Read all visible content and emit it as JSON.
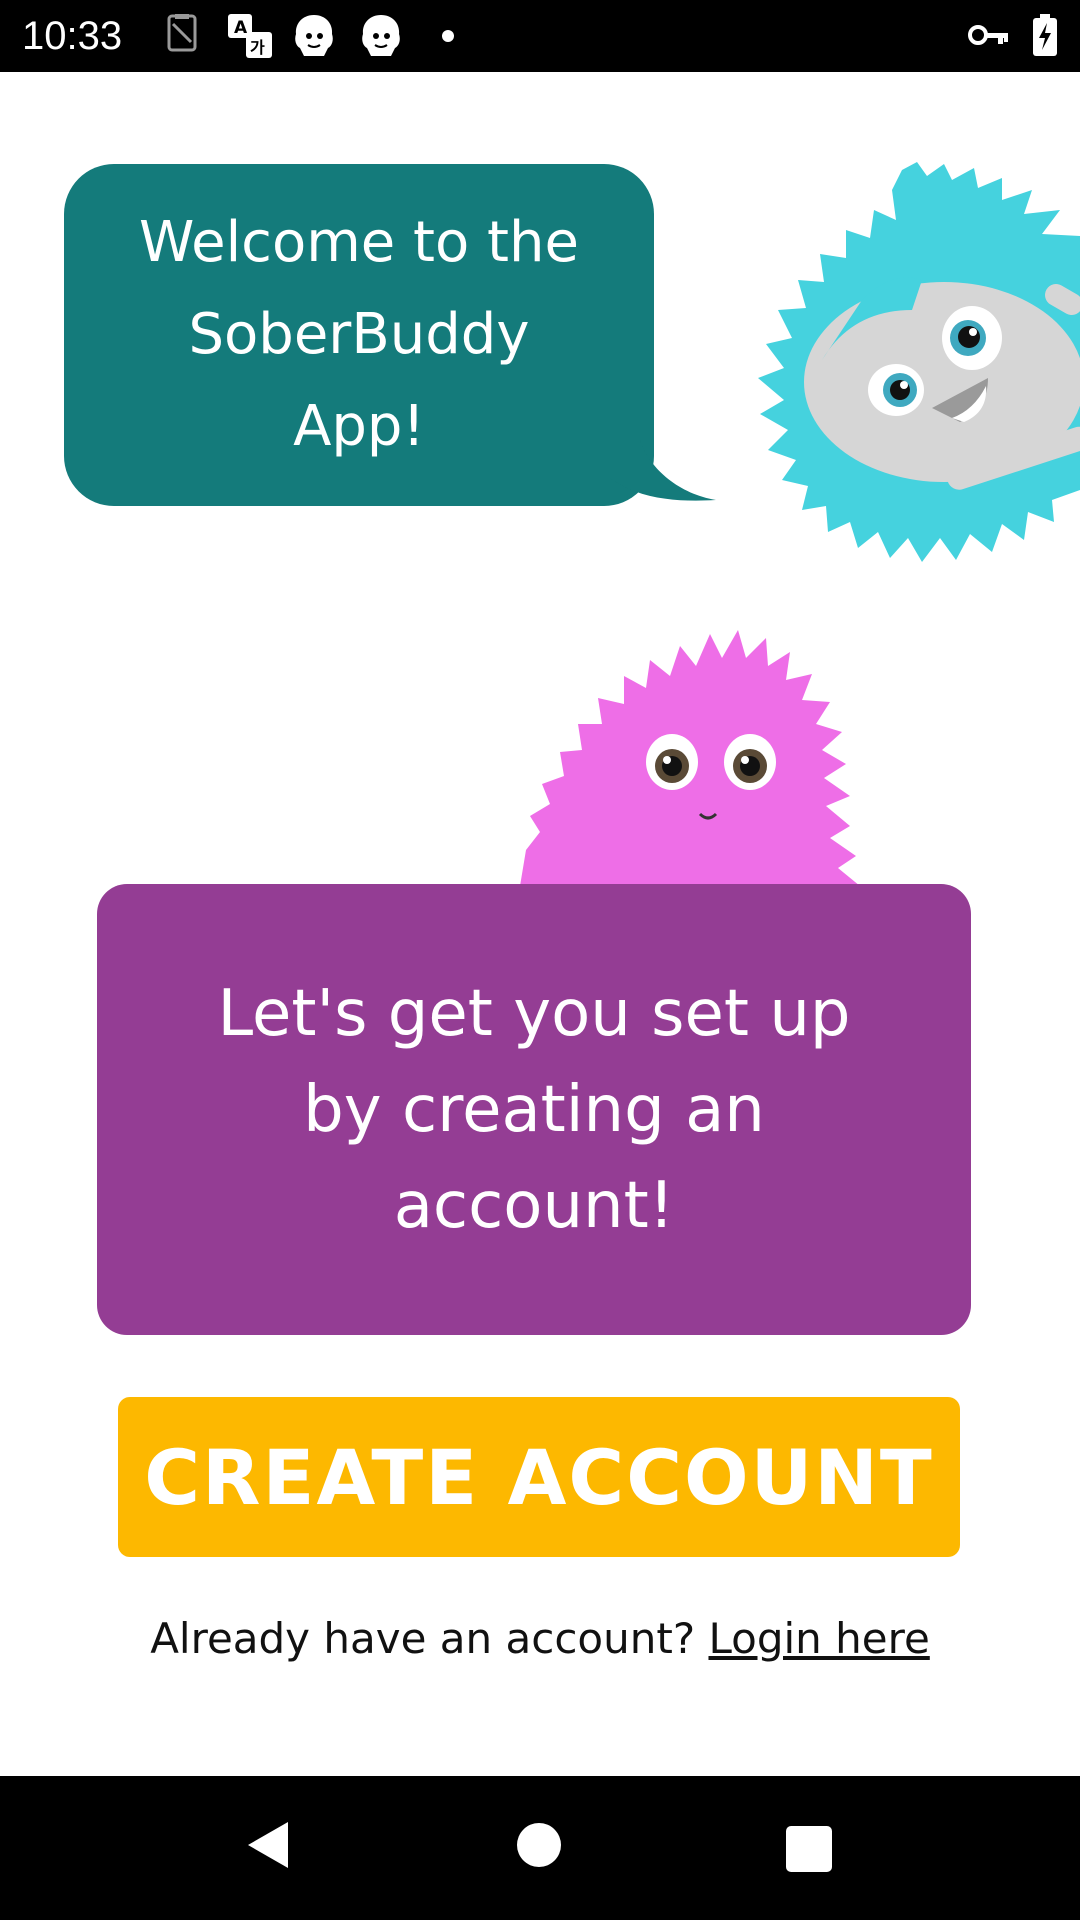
{
  "status_bar": {
    "time": "10:33",
    "icons": [
      "sim-card-icon",
      "translate-icon",
      "app-avatar-icon",
      "app-avatar-icon",
      "notification-dot-icon",
      "vpn-key-icon",
      "battery-charging-icon"
    ]
  },
  "welcome": {
    "line1": "Welcome to the",
    "line2": "SoberBuddy",
    "line3": "App!"
  },
  "setup": {
    "line1": "Let's get you set up",
    "line2": "by creating an",
    "line3": "account!"
  },
  "create_button": {
    "label": "CREATE ACCOUNT"
  },
  "login": {
    "prompt": "Already have an account?",
    "link": "Login here"
  },
  "colors": {
    "teal_bubble": "#147b7b",
    "purple_card": "#943d94",
    "cta_yellow": "#fdb800",
    "blue_monster": "#45d2de",
    "pink_monster": "#ee6ee7"
  },
  "nav": {
    "icons": [
      "back-icon",
      "home-icon",
      "recents-icon"
    ]
  }
}
